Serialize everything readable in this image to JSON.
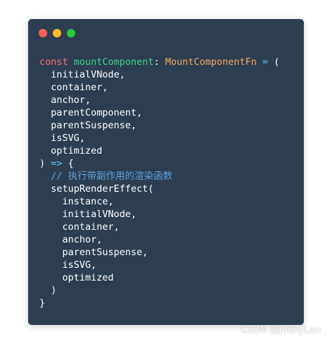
{
  "window": {
    "controls": [
      {
        "name": "close",
        "color": "#ff5f56"
      },
      {
        "name": "minimize",
        "color": "#ffbd2e"
      },
      {
        "name": "maximize",
        "color": "#27c93f"
      }
    ]
  },
  "code": {
    "lines": [
      {
        "indent": "",
        "tokens": [
          {
            "type": "kw",
            "text": "const"
          },
          {
            "type": "plain",
            "text": " "
          },
          {
            "type": "fn",
            "text": "mountComponent"
          },
          {
            "type": "plain",
            "text": ": "
          },
          {
            "type": "ty",
            "text": "MountComponentFn"
          },
          {
            "type": "plain",
            "text": " "
          },
          {
            "type": "op",
            "text": "="
          },
          {
            "type": "plain",
            "text": " ("
          }
        ]
      },
      {
        "indent": "  ",
        "tokens": [
          {
            "type": "plain",
            "text": "initialVNode,"
          }
        ]
      },
      {
        "indent": "  ",
        "tokens": [
          {
            "type": "plain",
            "text": "container,"
          }
        ]
      },
      {
        "indent": "  ",
        "tokens": [
          {
            "type": "plain",
            "text": "anchor,"
          }
        ]
      },
      {
        "indent": "  ",
        "tokens": [
          {
            "type": "plain",
            "text": "parentComponent,"
          }
        ]
      },
      {
        "indent": "  ",
        "tokens": [
          {
            "type": "plain",
            "text": "parentSuspense,"
          }
        ]
      },
      {
        "indent": "  ",
        "tokens": [
          {
            "type": "plain",
            "text": "isSVG,"
          }
        ]
      },
      {
        "indent": "  ",
        "tokens": [
          {
            "type": "plain",
            "text": "optimized"
          }
        ]
      },
      {
        "indent": "",
        "tokens": [
          {
            "type": "plain",
            "text": ") "
          },
          {
            "type": "op",
            "text": "=>"
          },
          {
            "type": "plain",
            "text": " {"
          }
        ]
      },
      {
        "indent": "  ",
        "tokens": [
          {
            "type": "cm",
            "text": "// 执行带副作用的渲染函数"
          }
        ]
      },
      {
        "indent": "  ",
        "tokens": [
          {
            "type": "plain",
            "text": "setupRenderEffect("
          }
        ]
      },
      {
        "indent": "    ",
        "tokens": [
          {
            "type": "plain",
            "text": "instance,"
          }
        ]
      },
      {
        "indent": "    ",
        "tokens": [
          {
            "type": "plain",
            "text": "initialVNode,"
          }
        ]
      },
      {
        "indent": "    ",
        "tokens": [
          {
            "type": "plain",
            "text": "container,"
          }
        ]
      },
      {
        "indent": "    ",
        "tokens": [
          {
            "type": "plain",
            "text": "anchor,"
          }
        ]
      },
      {
        "indent": "    ",
        "tokens": [
          {
            "type": "plain",
            "text": "parentSuspense,"
          }
        ]
      },
      {
        "indent": "    ",
        "tokens": [
          {
            "type": "plain",
            "text": "isSVG,"
          }
        ]
      },
      {
        "indent": "    ",
        "tokens": [
          {
            "type": "plain",
            "text": "optimized"
          }
        ]
      },
      {
        "indent": "  ",
        "tokens": [
          {
            "type": "plain",
            "text": ")"
          }
        ]
      },
      {
        "indent": "",
        "tokens": [
          {
            "type": "plain",
            "text": "}"
          }
        ]
      }
    ]
  },
  "watermark": "CSDN @JonnyLan"
}
